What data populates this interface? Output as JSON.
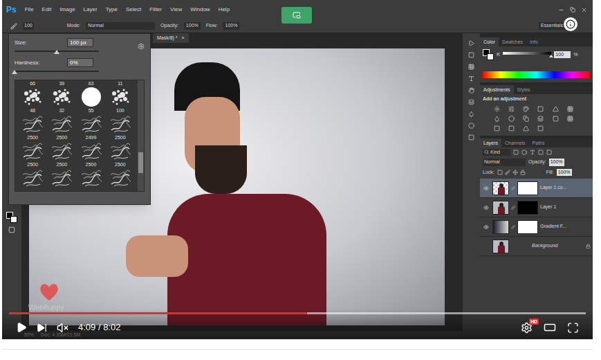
{
  "app": {
    "logo": "Ps",
    "menu": [
      "File",
      "Edit",
      "Image",
      "Layer",
      "Type",
      "Select",
      "Filter",
      "View",
      "Window",
      "Help"
    ],
    "options_bar": {
      "brush_size": "100",
      "mode_label": "Mode:",
      "mode": "Normal",
      "opacity_label": "Opacity:",
      "opacity": "100%",
      "flow_label": "Flow:",
      "flow": "100%",
      "workspace": "Essentials"
    },
    "brush_picker": {
      "size_label": "Size:",
      "size": "100 px",
      "size_level": 0.5,
      "hardness_label": "Hardness:",
      "hardness": "0%",
      "hardness_level": 0,
      "top_labels": [
        "66",
        "39",
        "63",
        "11"
      ],
      "rows": [
        [
          {
            "kind": "spatter",
            "label": "48"
          },
          {
            "kind": "spatter",
            "label": "32"
          },
          {
            "kind": "round",
            "label": "55"
          },
          {
            "kind": "spatter",
            "label": "100"
          }
        ],
        [
          {
            "kind": "smoke",
            "label": "2500"
          },
          {
            "kind": "smoke",
            "label": "2500"
          },
          {
            "kind": "smoke",
            "label": "2499"
          },
          {
            "kind": "smoke",
            "label": "2500"
          }
        ],
        [
          {
            "kind": "smoke",
            "label": "2500"
          },
          {
            "kind": "smoke",
            "label": "2500"
          },
          {
            "kind": "smoke",
            "label": "2500"
          },
          {
            "kind": "smoke",
            "label": "2500"
          }
        ]
      ],
      "partial_row": [
        "smoke",
        "smoke",
        "smoke",
        "smoke"
      ],
      "scroll_level": 0.8
    },
    "document_tab": {
      "title": "Mask/8) *",
      "close": "×"
    },
    "color_panel": {
      "tabs": [
        {
          "label": "Color",
          "selected": true
        },
        {
          "label": "Swatches",
          "selected": false
        },
        {
          "label": "Info",
          "selected": false
        }
      ],
      "channel": "K",
      "value": "100",
      "unit": "%",
      "level": 1
    },
    "adjustments_panel": {
      "tabs": [
        {
          "label": "Adjustments",
          "selected": true
        },
        {
          "label": "Styles",
          "selected": false
        }
      ],
      "hint": "Add an adjustment"
    },
    "layers_panel": {
      "tabs": [
        {
          "label": "Layers",
          "selected": true
        },
        {
          "label": "Channels",
          "selected": false
        },
        {
          "label": "Paths",
          "selected": false
        }
      ],
      "filter": "Kind",
      "blend_mode": "Normal",
      "opacity_label": "Opacity:",
      "opacity": "100%",
      "lock_label": "Lock:",
      "fill_label": "Fill:",
      "fill": "100%",
      "layers": [
        {
          "name": "Layer 1 co...",
          "visible": true,
          "selected": true,
          "thumb": "cutout",
          "mask": "white",
          "locked": false
        },
        {
          "name": "Layer 1",
          "visible": true,
          "selected": false,
          "thumb": "photo",
          "mask": "black",
          "locked": false
        },
        {
          "name": "Gradient F...",
          "visible": true,
          "selected": false,
          "thumb": "gradient",
          "mask": "white",
          "locked": false
        },
        {
          "name": "Background",
          "visible": false,
          "selected": false,
          "thumb": "photo",
          "mask": "none",
          "locked": true
        }
      ]
    },
    "status": {
      "zoom": "50%",
      "doc": "Doc: 4.35M/21.5M"
    }
  },
  "watermark": "Webfluppy",
  "player": {
    "played": 0.517,
    "buffered": 1,
    "time": "4:09 / 8:02",
    "quality_badge": "HD",
    "muted": true
  }
}
